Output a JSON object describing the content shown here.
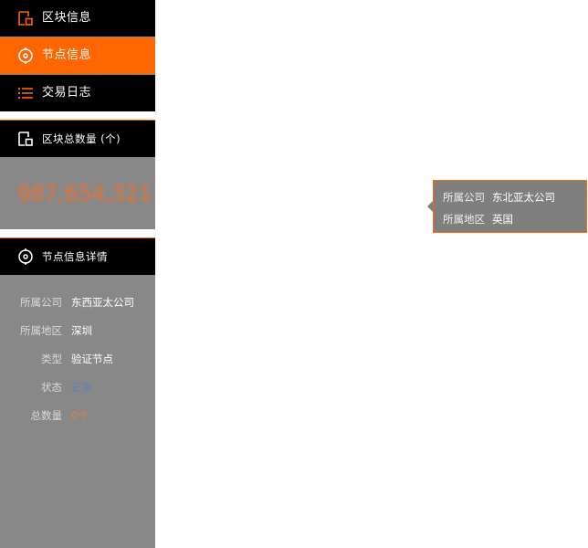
{
  "sidebar": {
    "nav": [
      {
        "label": "区块信息",
        "icon": "block-icon"
      },
      {
        "label": "节点信息",
        "icon": "node-icon",
        "active": true
      },
      {
        "label": "交易日志",
        "icon": "list-icon"
      }
    ],
    "total_header": {
      "label": "区块总数量 (个)",
      "icon": "block-icon"
    },
    "total_value": "987,654,321",
    "detail_header": {
      "label": "节点信息详情",
      "icon": "node-icon"
    },
    "details": [
      {
        "key": "所属公司",
        "value": "东西亚太公司"
      },
      {
        "key": "所属地区",
        "value": "深圳"
      },
      {
        "key": "类型",
        "value": "验证节点"
      },
      {
        "key": "状态",
        "value": "正常"
      },
      {
        "key": "总数量",
        "value": "0个"
      }
    ]
  },
  "tooltip": {
    "rows": [
      {
        "key": "所属公司",
        "value": "东北亚太公司"
      },
      {
        "key": "所属地区",
        "value": "英国"
      }
    ]
  },
  "colors": {
    "accent": "#ff6600",
    "nav_bg": "#000000",
    "panel_bg": "#888888",
    "status": "#4c7fd0"
  }
}
